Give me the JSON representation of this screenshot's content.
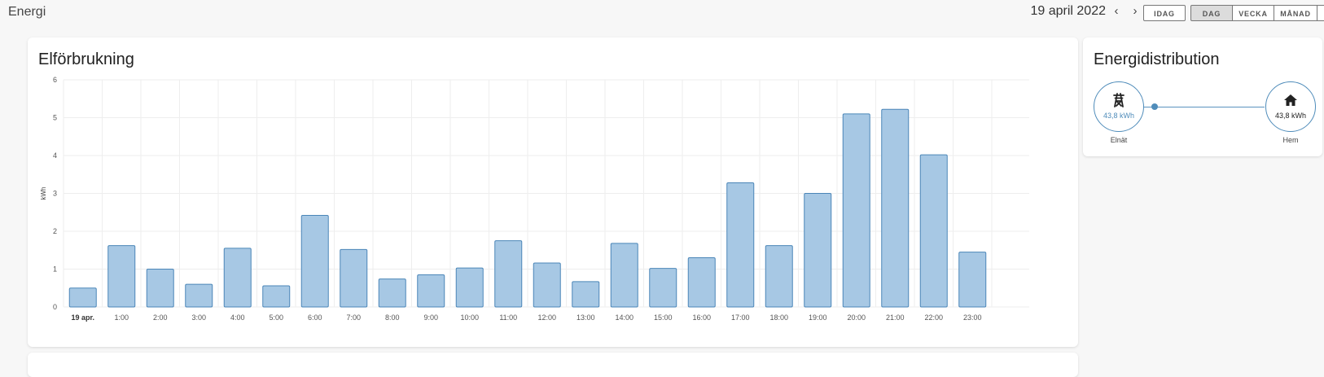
{
  "header": {
    "title": "Energi",
    "date": "19 april 2022",
    "prev_icon": "chevron-left-icon",
    "next_icon": "chevron-right-icon",
    "today_label": "IDAG",
    "periods": [
      "DAG",
      "VECKA",
      "MÅNAD"
    ],
    "active_period": "DAG"
  },
  "consumption_card": {
    "title": "Elförbrukning"
  },
  "chart_data": {
    "type": "bar",
    "title": "Elförbrukning",
    "xlabel": "",
    "ylabel": "kWh",
    "ylim": [
      0,
      6
    ],
    "yticks": [
      "0",
      "1",
      "2",
      "3",
      "4",
      "5",
      "6"
    ],
    "categories": [
      "19 apr.",
      "1:00",
      "2:00",
      "3:00",
      "4:00",
      "5:00",
      "6:00",
      "7:00",
      "8:00",
      "9:00",
      "10:00",
      "11:00",
      "12:00",
      "13:00",
      "14:00",
      "15:00",
      "16:00",
      "17:00",
      "18:00",
      "19:00",
      "20:00",
      "21:00",
      "22:00",
      "23:00"
    ],
    "values": [
      0.5,
      1.62,
      1.0,
      0.6,
      1.55,
      0.56,
      2.42,
      1.52,
      0.74,
      0.85,
      1.03,
      1.75,
      1.16,
      0.67,
      1.68,
      1.02,
      1.3,
      3.28,
      1.62,
      3.0,
      5.1,
      5.22,
      4.02,
      1.45
    ],
    "grid": true,
    "bar_fill": "#a7c8e4",
    "bar_stroke": "#4b86b8"
  },
  "distribution_card": {
    "title": "Energidistribution",
    "grid": {
      "icon": "transmission-tower-icon",
      "value": "43,8 kWh",
      "label": "Elnät"
    },
    "home": {
      "icon": "home-icon",
      "value": "43,8 kWh",
      "label": "Hem"
    },
    "accent_color": "#4f8cba"
  }
}
